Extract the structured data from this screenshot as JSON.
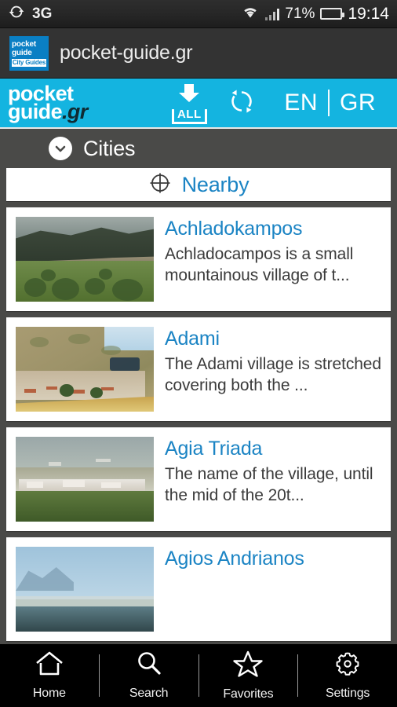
{
  "statusbar": {
    "sync_icon": "sync-icon",
    "network": "3G",
    "wifi_icon": "wifi-icon",
    "signal_icon": "signal-bars-icon",
    "battery_percent": "71%",
    "battery_icon": "battery-icon",
    "clock": "19:14"
  },
  "browser": {
    "favicon_line1": "pocket",
    "favicon_line2": "guide",
    "favicon_sub": "City Guides",
    "title": "pocket-guide.gr"
  },
  "appheader": {
    "logo_line1": "pocket",
    "logo_line2": "guide",
    "logo_suffix": ".gr",
    "download_all_label": "ALL",
    "download_all_icon": "download-arrow-icon",
    "refresh_icon": "refresh-icon",
    "lang_en": "EN",
    "lang_gr": "GR",
    "background_color": "#14b4e0"
  },
  "section": {
    "icon": "check-circle-icon",
    "title": "Cities"
  },
  "nearby": {
    "icon": "crosshair-icon",
    "label": "Nearby",
    "accent_color": "#1b84c4"
  },
  "cities": [
    {
      "name": "Achladokampos",
      "description": "Achladocampos is a small mountainous village of t...",
      "thumbnail": "green-hillside-photo"
    },
    {
      "name": "Adami",
      "description": "The Adami village is stretched covering both the ...",
      "thumbnail": "hillside-village-photo"
    },
    {
      "name": "Agia Triada",
      "description": "The name of the village, until the mid of the 20t...",
      "thumbnail": "valley-town-photo"
    },
    {
      "name": "Agios Andrianos",
      "description": "",
      "thumbnail": "hazy-coast-photo"
    }
  ],
  "bottomnav": [
    {
      "label": "Home",
      "icon": "home-icon"
    },
    {
      "label": "Search",
      "icon": "search-icon"
    },
    {
      "label": "Favorites",
      "icon": "star-icon"
    },
    {
      "label": "Settings",
      "icon": "gear-icon"
    }
  ]
}
